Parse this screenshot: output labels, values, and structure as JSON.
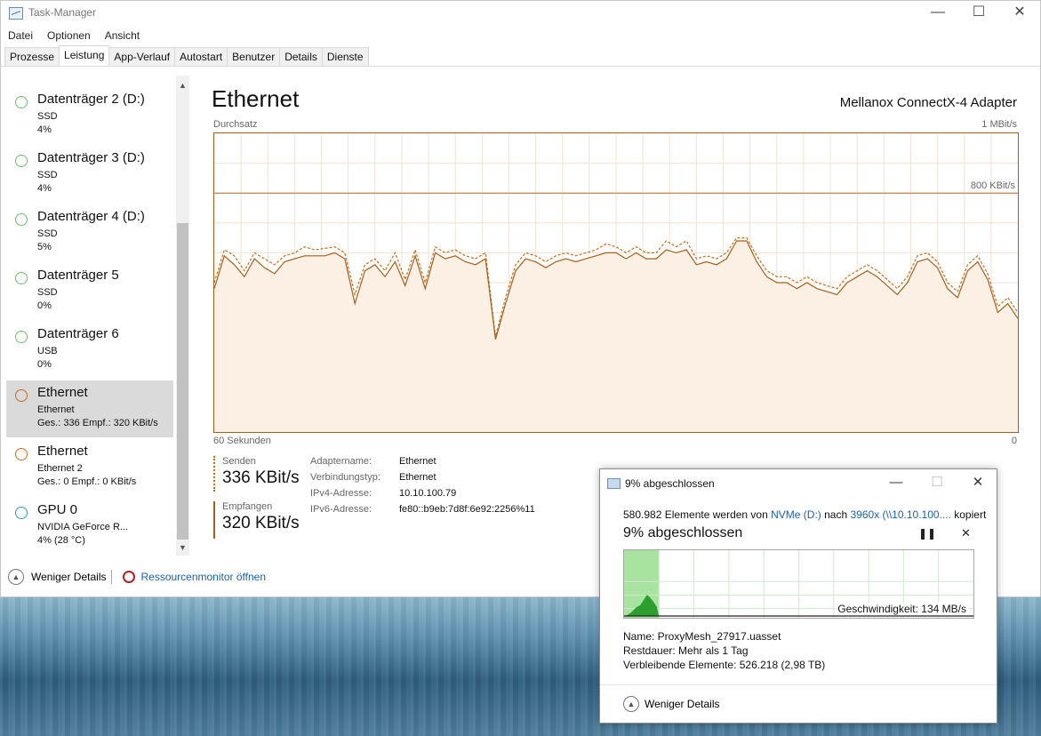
{
  "window": {
    "title": "Task-Manager",
    "minimize": "—",
    "maximize": "☐",
    "close": "✕"
  },
  "menu": [
    "Datei",
    "Optionen",
    "Ansicht"
  ],
  "tabs": [
    "Prozesse",
    "Leistung",
    "App-Verlauf",
    "Autostart",
    "Benutzer",
    "Details",
    "Dienste"
  ],
  "active_tab": "Leistung",
  "sidebar": {
    "items": [
      {
        "title": "Datenträger 2 (D:)",
        "sub": "SSD",
        "value": "4%",
        "color": "#6fbf6f"
      },
      {
        "title": "Datenträger 3 (D:)",
        "sub": "SSD",
        "value": "4%",
        "color": "#6fbf6f"
      },
      {
        "title": "Datenträger 4 (D:)",
        "sub": "SSD",
        "value": "5%",
        "color": "#6fbf6f"
      },
      {
        "title": "Datenträger 5",
        "sub": "SSD",
        "value": "0%",
        "color": "#6fbf6f"
      },
      {
        "title": "Datenträger 6",
        "sub": "USB",
        "value": "0%",
        "color": "#6fbf6f"
      },
      {
        "title": "Ethernet",
        "sub": "Ethernet",
        "value": "Ges.: 336 Empf.: 320 KBit/s",
        "color": "#c56e1f",
        "selected": true
      },
      {
        "title": "Ethernet",
        "sub": "Ethernet 2",
        "value": "Ges.: 0 Empf.: 0 KBit/s",
        "color": "#c56e1f"
      },
      {
        "title": "GPU 0",
        "sub": "NVIDIA GeForce R...",
        "value": "4% (28 °C)",
        "color": "#3a8fd6"
      }
    ]
  },
  "main": {
    "title": "Ethernet",
    "adapter": "Mellanox ConnectX-4 Adapter",
    "graph_label": "Durchsatz",
    "max_label": "1 MBit/s",
    "ref_label": "800 KBit/s",
    "time_label": "60 Sekunden",
    "zero_label": "0",
    "send_label": "Senden",
    "send_value": "336 KBit/s",
    "recv_label": "Empfangen",
    "recv_value": "320 KBit/s",
    "props": [
      {
        "k": "Adaptername:",
        "v": "Ethernet"
      },
      {
        "k": "Verbindungstyp:",
        "v": "Ethernet"
      },
      {
        "k": "IPv4-Adresse:",
        "v": "10.10.100.79"
      },
      {
        "k": "IPv6-Adresse:",
        "v": "fe80::b9eb:7d8f:6e92:2256%11"
      }
    ]
  },
  "chart_data": {
    "type": "line",
    "ylim": [
      0,
      1000
    ],
    "ylabel_max": "1 MBit/s",
    "reference_line": 800,
    "x_range_seconds": 60,
    "series": [
      {
        "name": "Senden",
        "style": "dashed",
        "color": "#c56e1f",
        "values": [
          500,
          610,
          590,
          540,
          600,
          580,
          560,
          590,
          600,
          620,
          610,
          615,
          620,
          600,
          460,
          560,
          580,
          540,
          600,
          510,
          610,
          500,
          620,
          600,
          610,
          590,
          580,
          600,
          320,
          450,
          560,
          600,
          590,
          570,
          590,
          600,
          590,
          600,
          610,
          630,
          620,
          600,
          620,
          600,
          600,
          640,
          620,
          640,
          580,
          590,
          580,
          600,
          650,
          650,
          590,
          540,
          520,
          520,
          500,
          520,
          500,
          490,
          480,
          520,
          540,
          560,
          540,
          510,
          480,
          520,
          590,
          600,
          570,
          500,
          470,
          560,
          590,
          530,
          420,
          450,
          400
        ]
      },
      {
        "name": "Empfangen",
        "style": "solid",
        "color": "#a45f1c",
        "values": [
          480,
          590,
          560,
          520,
          580,
          550,
          530,
          570,
          580,
          590,
          590,
          590,
          600,
          580,
          430,
          540,
          560,
          520,
          570,
          490,
          590,
          480,
          600,
          580,
          590,
          570,
          560,
          580,
          310,
          430,
          540,
          580,
          570,
          550,
          570,
          580,
          570,
          580,
          590,
          600,
          600,
          580,
          600,
          580,
          580,
          610,
          600,
          610,
          560,
          570,
          560,
          580,
          640,
          640,
          570,
          520,
          500,
          500,
          480,
          500,
          480,
          470,
          460,
          500,
          520,
          540,
          520,
          490,
          460,
          500,
          570,
          580,
          550,
          480,
          450,
          540,
          570,
          510,
          400,
          430,
          380
        ]
      }
    ]
  },
  "bottom": {
    "less_details": "Weniger Details",
    "resmon": "Ressourcenmonitor öffnen"
  },
  "dialog": {
    "title": "9% abgeschlossen",
    "line1_prefix": "580.982 Elemente werden von ",
    "line1_src": "NVMe (D:)",
    "line1_mid": " nach ",
    "line1_dst": "3960x (\\\\10.10.100....",
    "line1_suffix": " kopiert",
    "percent": "9% abgeschlossen",
    "progress": 0.09,
    "speed": "Geschwindigkeit: 134 MB/s",
    "name": "Name:  ProxyMesh_27917.uasset",
    "remaining": "Restdauer:  Mehr als 1 Tag",
    "items_left": "Verbleibende Elemente:  526.218 (2,98 TB)",
    "less_details": "Weniger Details",
    "pause": "❚❚",
    "cancel": "✕"
  }
}
